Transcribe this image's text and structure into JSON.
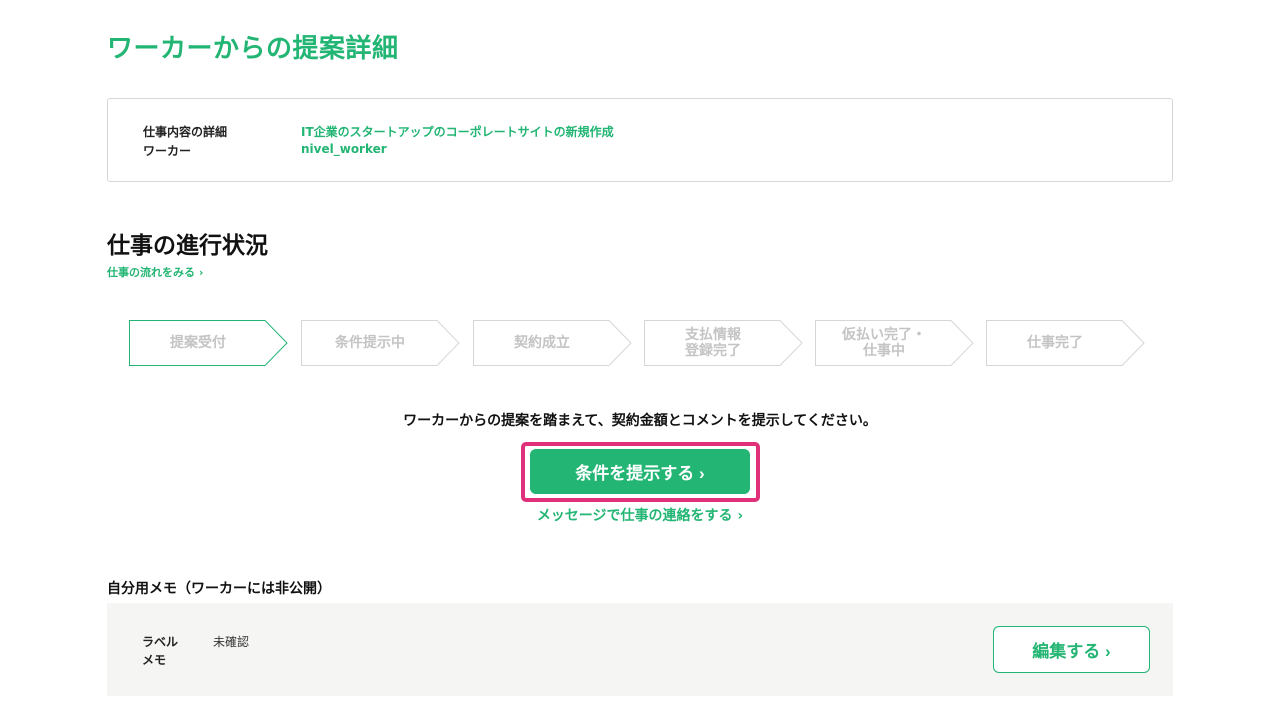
{
  "page": {
    "title": "ワーカーからの提案詳細"
  },
  "details": {
    "job_label": "仕事内容の詳細",
    "job_value": "IT企業のスタートアップのコーポレートサイトの新規作成",
    "worker_label": "ワーカー",
    "worker_value": "nivel_worker"
  },
  "progress": {
    "title": "仕事の進行状況",
    "flow_link": "仕事の流れをみる ›",
    "steps": [
      {
        "label": "提案受付",
        "active": true
      },
      {
        "label": "条件提示中",
        "active": false
      },
      {
        "label": "契約成立",
        "active": false
      },
      {
        "label": "支払情報\n登録完了",
        "active": false
      },
      {
        "label": "仮払い完了・\n仕事中",
        "active": false
      },
      {
        "label": "仕事完了",
        "active": false
      }
    ]
  },
  "action": {
    "instruction": "ワーカーからの提案を踏まえて、契約金額とコメントを提示してください。",
    "primary_label": "条件を提示する ›",
    "message_link": "メッセージで仕事の連絡をする ›"
  },
  "memo": {
    "title": "自分用メモ（ワーカーには非公開）",
    "label_label": "ラベル",
    "label_value": "未確認",
    "memo_label": "メモ",
    "memo_value": "",
    "edit_label": "編集する ›"
  },
  "colors": {
    "accent": "#22b573",
    "highlight": "#e0307a",
    "muted": "#c4c4c4"
  }
}
